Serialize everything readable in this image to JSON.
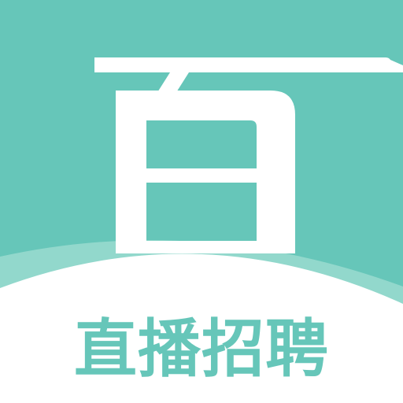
{
  "app_icon": {
    "logo_glyph": "百",
    "caption": "直播招聘",
    "colors": {
      "primary": "#66c6b9",
      "secondary": "#92d8cc",
      "background": "#ffffff",
      "glyph": "#ffffff"
    }
  }
}
